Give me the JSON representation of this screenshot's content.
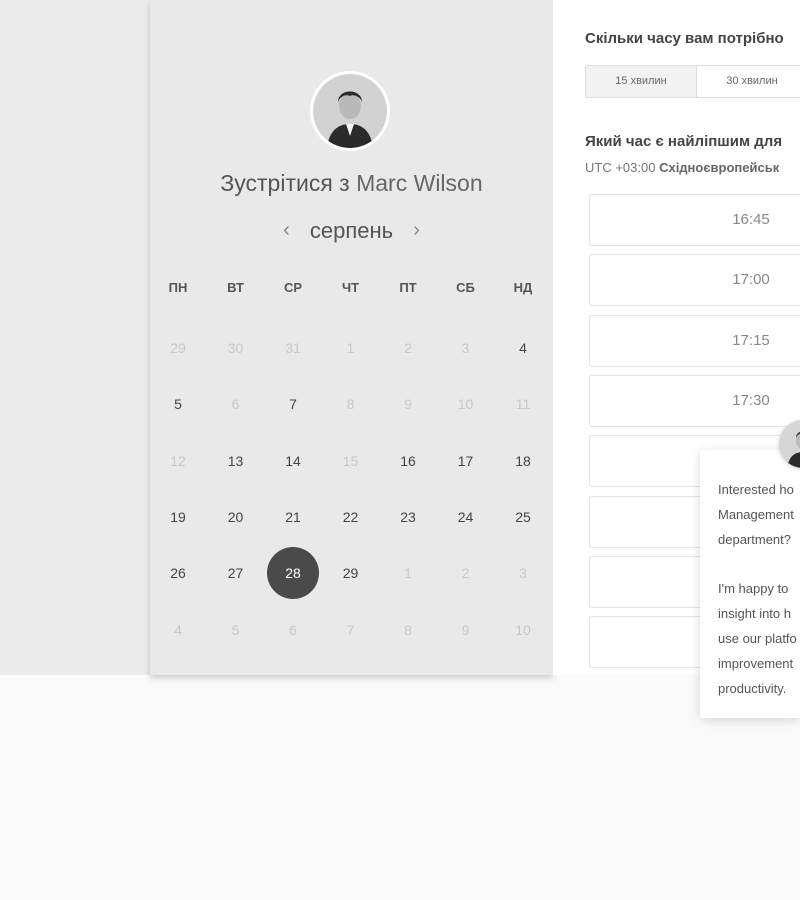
{
  "meeting": {
    "title_prefix": "Зустрітися з",
    "host_name": "Marc Wilson"
  },
  "calendar": {
    "month": "серпень",
    "prev_icon": "chevron-left-icon",
    "next_icon": "chevron-right-icon",
    "weekdays": [
      "ПН",
      "ВТ",
      "СР",
      "ЧТ",
      "ПТ",
      "СБ",
      "НД"
    ],
    "weeks": [
      [
        {
          "d": "29",
          "s": "muted"
        },
        {
          "d": "30",
          "s": "muted"
        },
        {
          "d": "31",
          "s": "muted"
        },
        {
          "d": "1",
          "s": "muted"
        },
        {
          "d": "2",
          "s": "muted"
        },
        {
          "d": "3",
          "s": "muted"
        },
        {
          "d": "4",
          "s": "active"
        }
      ],
      [
        {
          "d": "5",
          "s": "active"
        },
        {
          "d": "6",
          "s": "muted"
        },
        {
          "d": "7",
          "s": "active"
        },
        {
          "d": "8",
          "s": "muted"
        },
        {
          "d": "9",
          "s": "muted"
        },
        {
          "d": "10",
          "s": "muted"
        },
        {
          "d": "11",
          "s": "muted"
        }
      ],
      [
        {
          "d": "12",
          "s": "muted"
        },
        {
          "d": "13",
          "s": "active"
        },
        {
          "d": "14",
          "s": "active"
        },
        {
          "d": "15",
          "s": "muted"
        },
        {
          "d": "16",
          "s": "active"
        },
        {
          "d": "17",
          "s": "active"
        },
        {
          "d": "18",
          "s": "active"
        }
      ],
      [
        {
          "d": "19",
          "s": "active"
        },
        {
          "d": "20",
          "s": "active"
        },
        {
          "d": "21",
          "s": "active"
        },
        {
          "d": "22",
          "s": "active"
        },
        {
          "d": "23",
          "s": "active"
        },
        {
          "d": "24",
          "s": "active"
        },
        {
          "d": "25",
          "s": "active"
        }
      ],
      [
        {
          "d": "26",
          "s": "active"
        },
        {
          "d": "27",
          "s": "active"
        },
        {
          "d": "28",
          "s": "selected"
        },
        {
          "d": "29",
          "s": "active"
        },
        {
          "d": "1",
          "s": "muted"
        },
        {
          "d": "2",
          "s": "muted"
        },
        {
          "d": "3",
          "s": "muted"
        }
      ],
      [
        {
          "d": "4",
          "s": "muted"
        },
        {
          "d": "5",
          "s": "muted"
        },
        {
          "d": "6",
          "s": "muted"
        },
        {
          "d": "7",
          "s": "muted"
        },
        {
          "d": "8",
          "s": "muted"
        },
        {
          "d": "9",
          "s": "muted"
        },
        {
          "d": "10",
          "s": "muted"
        }
      ]
    ]
  },
  "duration": {
    "question": "Скільки часу вам потрібно",
    "options": [
      "15 хвилин",
      "30 хвилин"
    ],
    "selected_index": 0
  },
  "time": {
    "question": "Який час є найліпшим для",
    "timezone_offset": "UTC +03:00",
    "timezone_name": "Східноєвропейськ",
    "slots": [
      "16:45",
      "17:00",
      "17:15",
      "17:30",
      "",
      "",
      "",
      ""
    ]
  },
  "chat": {
    "lines": [
      "Interested ho",
      "Management",
      "department?",
      "",
      "I'm happy to",
      "insight into h",
      "use our platfo",
      "improvement",
      "productivity."
    ]
  },
  "colors": {
    "selected_day": "#4a4a4a",
    "panel_bg": "#e9e9e9"
  }
}
